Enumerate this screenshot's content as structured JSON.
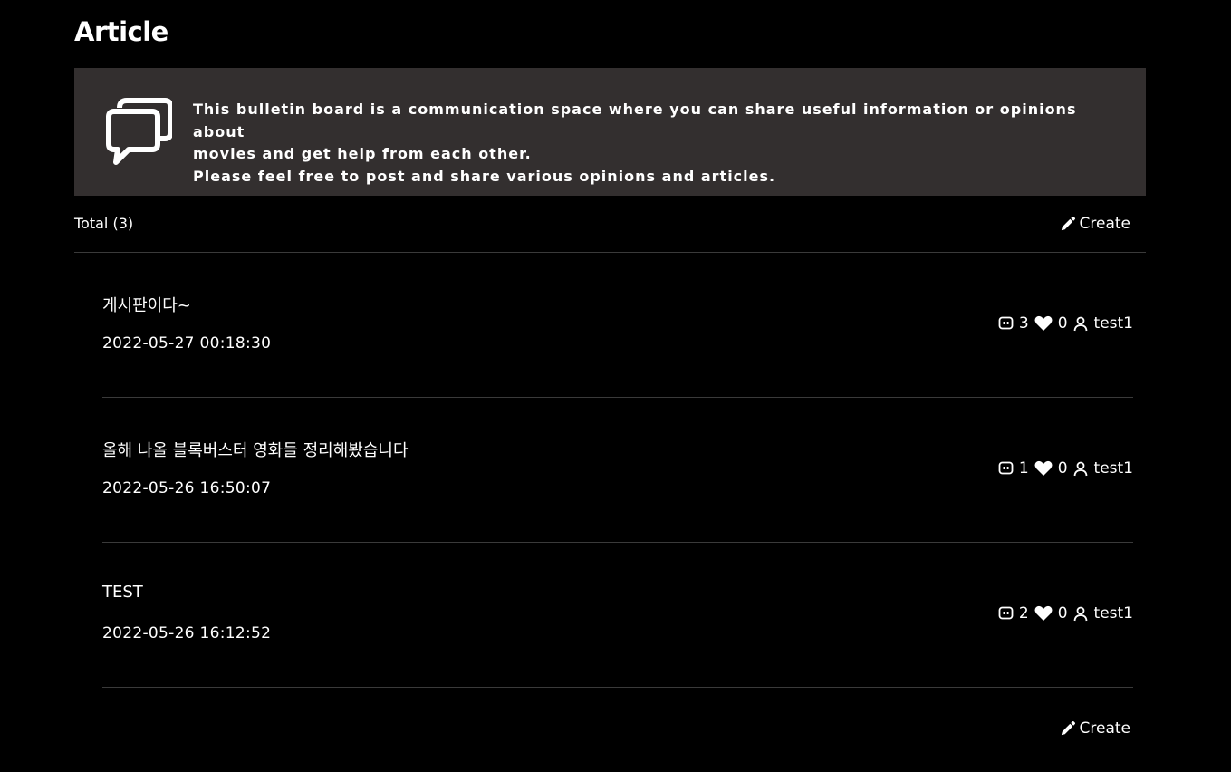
{
  "page": {
    "title": "Article"
  },
  "banner": {
    "icon": "chat-bubbles-icon",
    "line1": "This bulletin board is a communication space where you can share useful information or opinions about",
    "line2": "movies and get help from each other.",
    "line3": "Please feel free to post and share various opinions and articles."
  },
  "toolbar": {
    "total_label": "Total (3)",
    "create_label": "Create",
    "create_icon": "pencil-icon"
  },
  "articles": [
    {
      "title": "게시판이다~",
      "date": "2022-05-27 00:18:30",
      "comments": "3",
      "likes": "0",
      "author": "test1"
    },
    {
      "title": "올해 나올 블록버스터 영화들 정리해봤습니다",
      "date": "2022-05-26 16:50:07",
      "comments": "1",
      "likes": "0",
      "author": "test1"
    },
    {
      "title": "TEST",
      "date": "2022-05-26 16:12:52",
      "comments": "2",
      "likes": "0",
      "author": "test1"
    }
  ],
  "footer": {
    "create_label": "Create"
  },
  "colors": {
    "background": "#000000",
    "banner_background": "#332f2f",
    "divider": "#3a3a3a",
    "text": "#ffffff"
  }
}
